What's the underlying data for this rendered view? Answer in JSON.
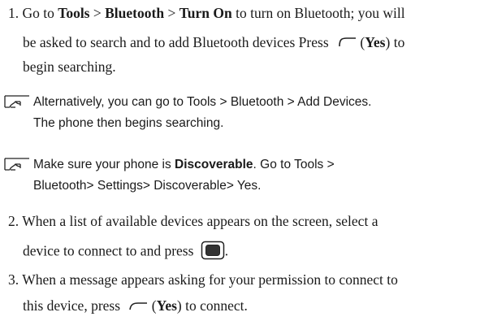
{
  "step1": {
    "num": "1.",
    "pre": "Go to",
    "tools": "Tools",
    "sep1": ">",
    "bluetooth": "Bluetooth",
    "sep2": ">",
    "turn_on": "Turn On",
    "post": "to turn on Bluetooth; you will",
    "line2_pre": "be asked to search and to add Bluetooth devices Press",
    "paren_open": "(",
    "yes": "Yes",
    "paren_close": ") to",
    "line3": "begin searching."
  },
  "note1": {
    "icon": "note-hand-icon",
    "line1": "Alternatively, you can go to Tools > Bluetooth > Add Devices.",
    "line2": "The phone then begins searching."
  },
  "note2": {
    "icon": "note-hand-icon",
    "pre": "Make sure your phone is",
    "bold": "Discoverable",
    "post": ". Go to Tools >",
    "line2": "Bluetooth> Settings> Discoverable> Yes."
  },
  "step2": {
    "num": "2.",
    "line1": "When a list of available devices appears on the screen, select a",
    "line2": "device to connect to and press",
    "end": "."
  },
  "step3": {
    "num": "3.",
    "line1": "When a message appears asking for your permission to connect to",
    "line2_pre": "this device, press",
    "paren_open": "(",
    "yes": "Yes",
    "paren_close": ") to connect."
  }
}
